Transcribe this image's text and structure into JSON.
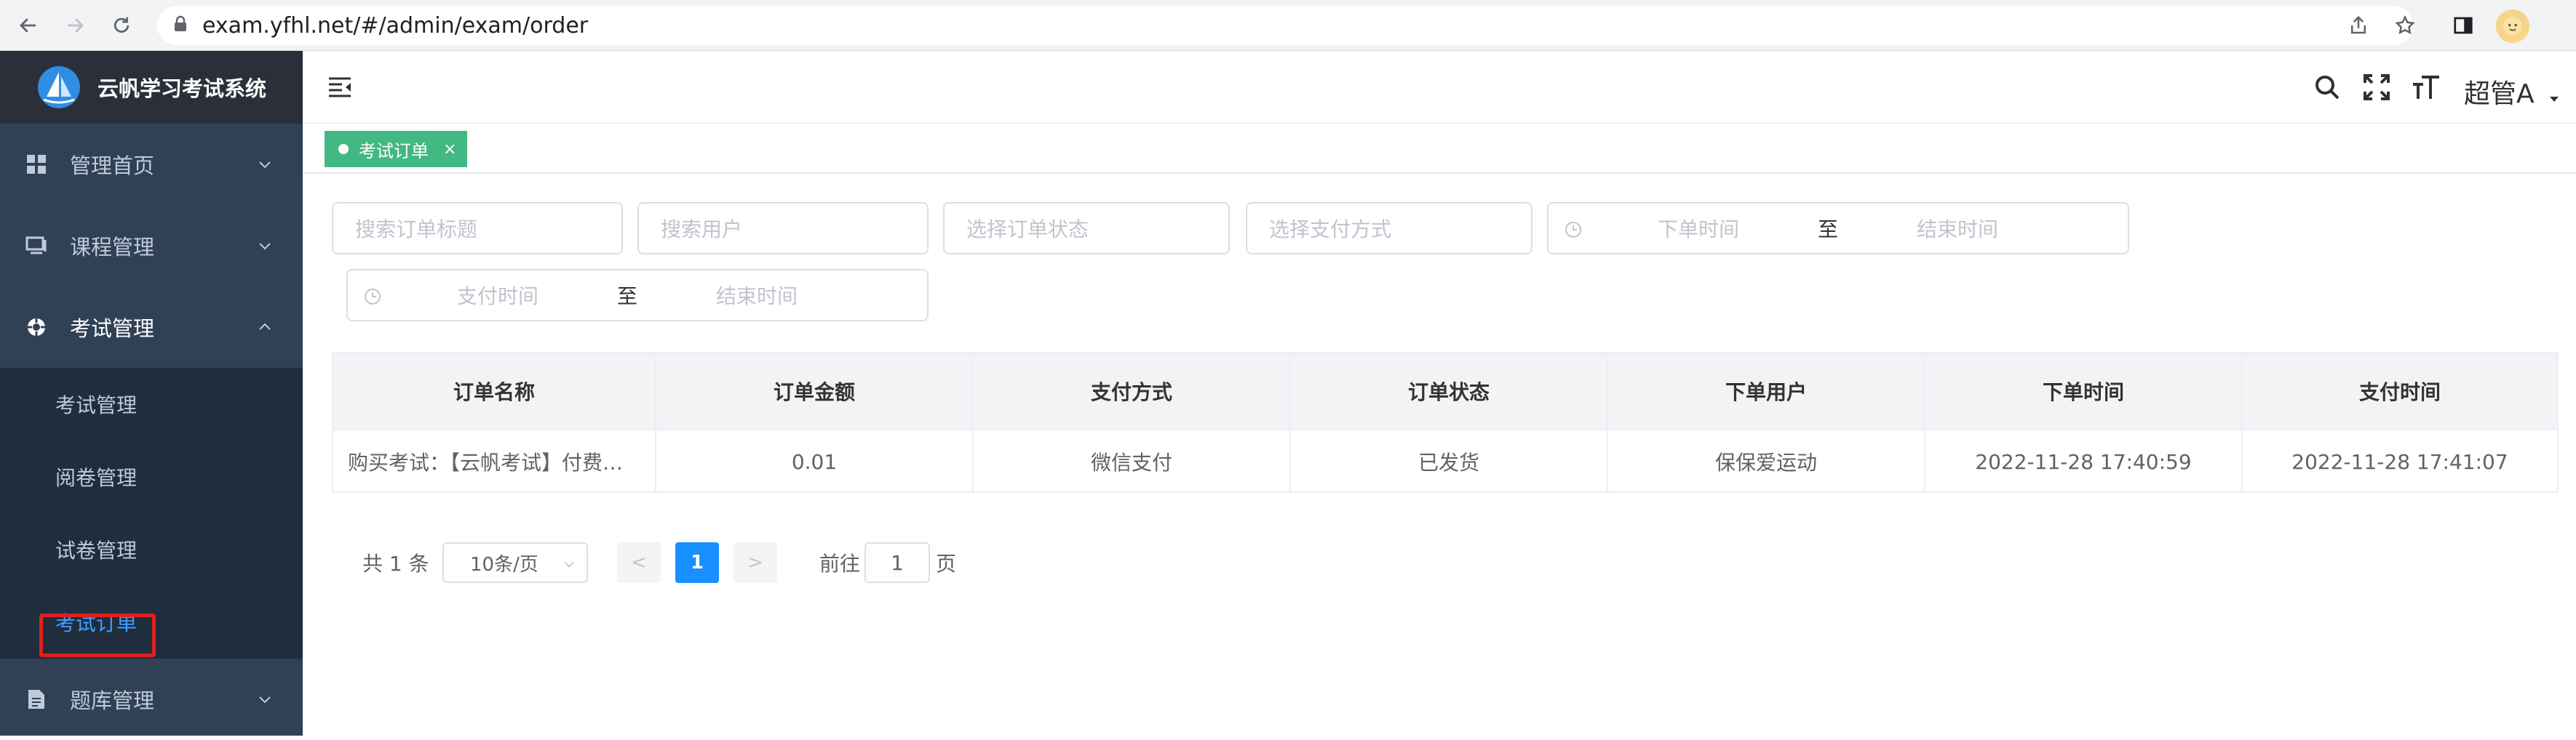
{
  "browser": {
    "url": "exam.yfhl.net/#/admin/exam/order"
  },
  "app": {
    "title": "云帆学习考试系统"
  },
  "sidebar": {
    "items": [
      {
        "label": "管理首页"
      },
      {
        "label": "课程管理"
      },
      {
        "label": "考试管理"
      },
      {
        "label": "题库管理"
      }
    ],
    "submenu": [
      {
        "label": "考试管理"
      },
      {
        "label": "阅卷管理"
      },
      {
        "label": "试卷管理"
      },
      {
        "label": "考试订单"
      }
    ]
  },
  "header": {
    "user": "超管A"
  },
  "tags": {
    "active": "考试订单",
    "close": "×"
  },
  "filters": {
    "title_placeholder": "搜索订单标题",
    "user_placeholder": "搜索用户",
    "status_placeholder": "选择订单状态",
    "payment_placeholder": "选择支付方式",
    "order_time": {
      "start": "下单时间",
      "sep": "至",
      "end": "结束时间"
    },
    "pay_time": {
      "start": "支付时间",
      "sep": "至",
      "end": "结束时间"
    }
  },
  "table": {
    "columns": [
      "订单名称",
      "订单金额",
      "支付方式",
      "订单状态",
      "下单用户",
      "下单时间",
      "支付时间"
    ],
    "rows": [
      [
        "购买考试：【云帆考试】付费考试",
        "0.01",
        "微信支付",
        "已发货",
        "保保爱运动",
        "2022-11-28 17:40:59",
        "2022-11-28 17:41:07"
      ]
    ]
  },
  "pagination": {
    "total": "共 1 条",
    "page_size": "10条/页",
    "prev": "<",
    "current": "1",
    "next": ">",
    "goto_label": "前往",
    "goto_value": "1",
    "page_suffix": "页"
  },
  "colors": {
    "sidebar_bg": "#304156",
    "accent": "#409eff",
    "tag_green": "#42b983",
    "highlight_red": "#e0201e"
  }
}
